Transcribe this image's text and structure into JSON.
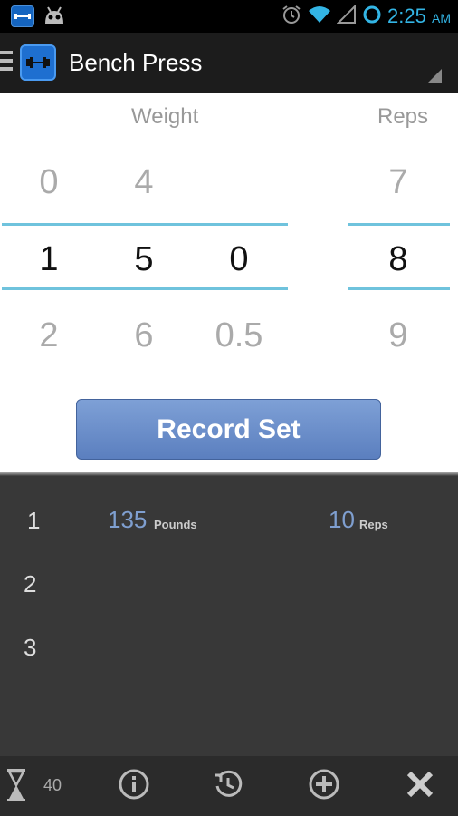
{
  "status_bar": {
    "time": "2:25",
    "ampm": "AM",
    "icons": [
      "app-notification-icon",
      "android-notification-icon",
      "alarm-icon",
      "wifi-icon",
      "signal-icon",
      "sync-circle-icon"
    ]
  },
  "action_bar": {
    "title": "Bench Press",
    "icons": [
      "menu-icon",
      "dumbbell-icon",
      "spinner-corner-icon"
    ]
  },
  "picker": {
    "weight_label": "Weight",
    "reps_label": "Reps",
    "weight_columns": [
      {
        "prev": "0",
        "current": "1",
        "next": "2"
      },
      {
        "prev": "4",
        "current": "5",
        "next": "6"
      },
      {
        "prev": "",
        "current": "0",
        "next": "0.5"
      }
    ],
    "reps_column": {
      "prev": "7",
      "current": "8",
      "next": "9"
    },
    "record_button": "Record Set"
  },
  "sets": {
    "numbers": [
      "1",
      "2",
      "3"
    ],
    "entries": [
      {
        "weight": "135",
        "weight_unit": "Pounds",
        "reps": "10",
        "reps_unit": "Reps"
      }
    ]
  },
  "bottom_bar": {
    "timer_value": "40",
    "icons": [
      "hourglass-icon",
      "info-icon",
      "history-icon",
      "add-icon",
      "close-icon"
    ]
  },
  "colors": {
    "accent": "#33b5e5",
    "picker_line": "#6fc3dd",
    "button": "#6a8fcc",
    "set_value": "#7f9fd0"
  }
}
